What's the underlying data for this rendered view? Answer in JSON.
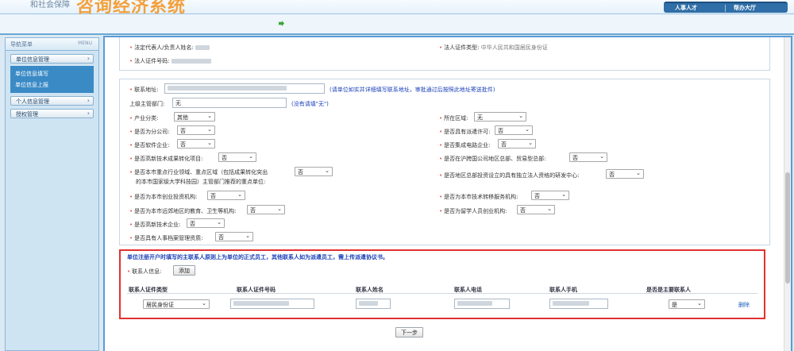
{
  "header": {
    "logo_small": "和社会保障",
    "logo_big": "咨询经济系统",
    "nav": [
      "人事人才",
      "帮办大厅"
    ]
  },
  "sidebar": {
    "title": "导航菜单",
    "menu_label": "MENU",
    "groups": [
      {
        "label": "单位信息管理",
        "children": [
          "单位信息填写",
          "单位信息上报"
        ]
      },
      {
        "label": "个人信息管理"
      },
      {
        "label": "授权管理"
      }
    ]
  },
  "form": {
    "legal_rep_label": "法定代表人/负责人姓名:",
    "legal_id_type_label": "法人证件类型:",
    "legal_id_type_value": "中华人民共和国居民身份证",
    "legal_id_no_label": "法人证件号码:",
    "address_label": "联系地址:",
    "address_hint": "(请单位如实并详细填写联系地址，审批通过后按照此地址寄送批件)",
    "supervisor_label": "上级主管部门:",
    "supervisor_value": "无",
    "supervisor_hint": "(没有请填\"无\")",
    "industry_label": "产业分类:",
    "industry_value": "其他",
    "region_label": "所在区域:",
    "region_value": "无",
    "branch_label": "是否为分公司:",
    "branch_value": "否",
    "dispatch_label": "是否具有派遣许可:",
    "dispatch_value": "否",
    "software_label": "是否软件企业:",
    "software_value": "否",
    "ic_label": "是否集成电路企业:",
    "ic_value": "否",
    "hitech_transform_label": "是否高新技术成果转化项目:",
    "hitech_transform_value": "否",
    "hq_label": "是否在沪跨国公司地区总部、贸易型总部:",
    "hq_value": "否",
    "key_area_label_1": "是否本市重点行业领域、重点区域（包括成果转化突出",
    "key_area_label_2": "的本市国家级大学科技园）主管部门推荐的重点单位:",
    "key_area_value": "否",
    "rd_center_label": "是否地区总部投资设立的具有独立法人资格的研发中心:",
    "rd_center_value": "否",
    "venture_label": "是否为本市创业投资机构:",
    "venture_value": "否",
    "tech_transfer_label": "是否为本市技术转移服务机构:",
    "tech_transfer_value": "否",
    "remote_label": "是否为本市远郊地区的教育、卫生等机构:",
    "remote_value": "否",
    "overseas_label": "是否为留学人员创业机构:",
    "overseas_value": "否",
    "hitech_label": "是否高新技术企业:",
    "hitech_value": "否",
    "hr_archive_label": "是否具有人事档案管理资质:",
    "hr_archive_value": "否"
  },
  "contact": {
    "note": "单位注册开户时填写的主联系人原则上为单位的正式员工，其他联系人如为派遣员工，需上传派遣协议书。",
    "info_label": "联系人信息:",
    "add_button": "添加",
    "columns": [
      "联系人证件类型",
      "联系人证件号码",
      "联系人姓名",
      "联系人电话",
      "联系人手机",
      "是否是主要联系人"
    ],
    "row": {
      "id_type": "居民身份证",
      "is_main": "是",
      "delete": "删除"
    }
  },
  "footer": {
    "next_button": "下一步"
  }
}
